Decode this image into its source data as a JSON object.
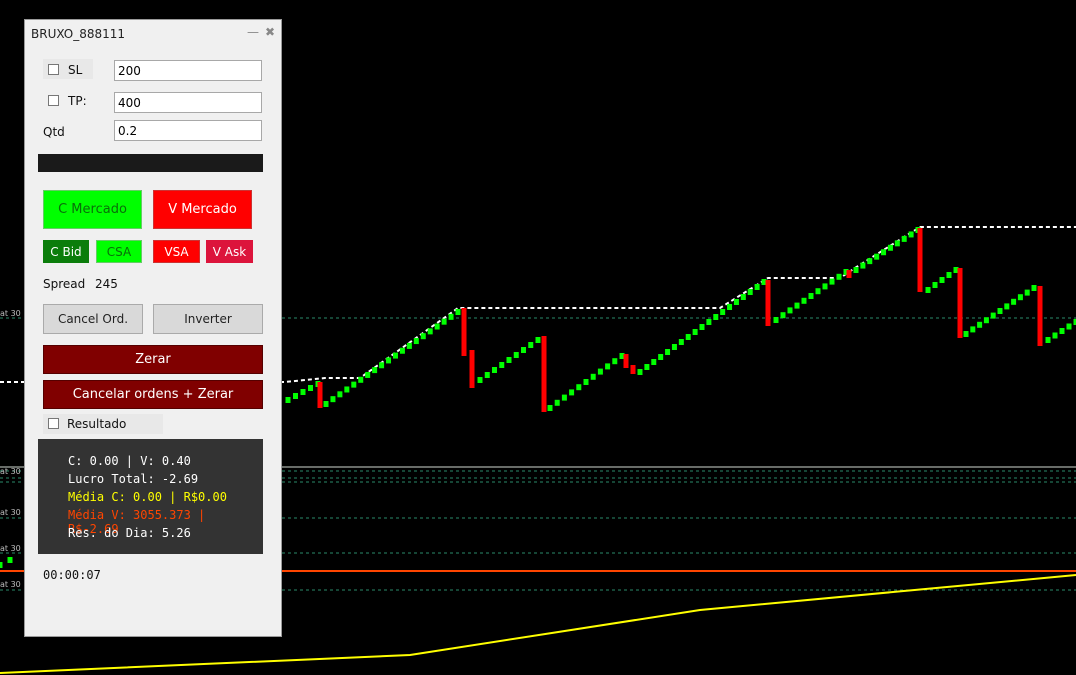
{
  "chart_data": {
    "type": "candlestick",
    "up_color": "#00ff00",
    "down_color": "#ff0000",
    "stop_line_color": "#ffffff",
    "moving_average_color": "#ffff00",
    "price_line_color": "#ff4500",
    "level_line_color": "#2a8a6a"
  },
  "axis_labels": [
    "at 30",
    "at 30",
    "at 30",
    "at 30",
    "at 30"
  ],
  "panel": {
    "title": "BRUXO_888111",
    "minimize_icon": "minimize-icon",
    "close_icon": "close-icon",
    "sl_label": "SL",
    "sl_value": "200",
    "tp_label": "TP:",
    "tp_value": "400",
    "qtd_label": "Qtd",
    "qtd_value": "0.2",
    "buy_market": "C Mercado",
    "sell_market": "V Mercado",
    "buy_bid": "C Bid",
    "buy_csa": "CSA",
    "sell_vsa": "VSA",
    "sell_ask": "V Ask",
    "spread_label": "Spread",
    "spread_value": "245",
    "cancel_orders": "Cancel Ord.",
    "invert": "Inverter",
    "zero": "Zerar",
    "cancel_and_zero": "Cancelar ordens + Zerar",
    "result_label": "Resultado",
    "result": {
      "line1": "C: 0.00 | V: 0.40",
      "line2": "Lucro Total: -2.69",
      "line3": "Média C: 0.00 | R$0.00",
      "line4": "Média V: 3055.373 | R$-2.69",
      "line5": "Res. do Dia: 5.26",
      "line1_color": "#ffffff",
      "line2_color": "#ffffff",
      "line3_color": "#ffff00",
      "line4_color": "#ff4500",
      "line5_color": "#ffffff"
    },
    "clock": "00:00:07"
  }
}
